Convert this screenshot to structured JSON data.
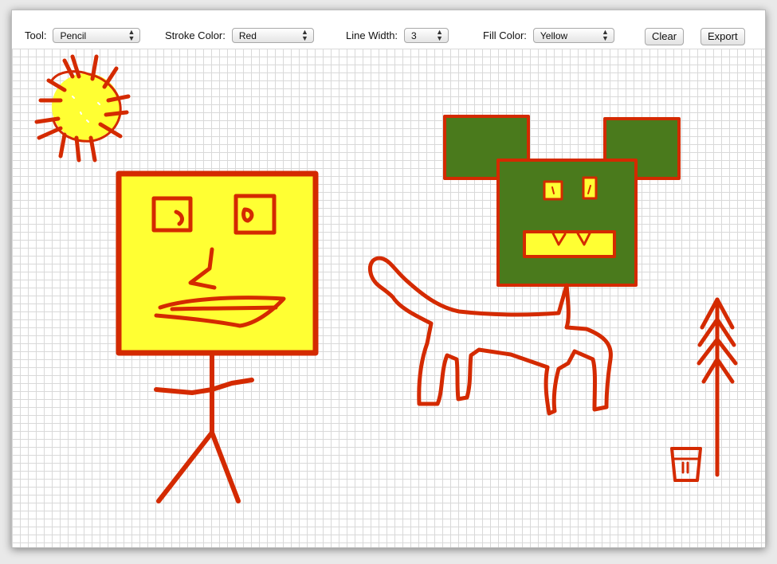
{
  "toolbar": {
    "tool_label": "Tool:",
    "tool_value": "Pencil",
    "stroke_label": "Stroke Color:",
    "stroke_value": "Red",
    "width_label": "Line Width:",
    "width_value": "3",
    "fill_label": "Fill Color:",
    "fill_value": "Yellow",
    "clear_label": "Clear",
    "export_label": "Export"
  },
  "colors": {
    "stroke": "#d42a00",
    "fill_yellow": "#ffff33",
    "fill_green": "#4a7a1c",
    "grid": "#d9d9d9"
  },
  "icons": {
    "select_arrow": "↕"
  }
}
